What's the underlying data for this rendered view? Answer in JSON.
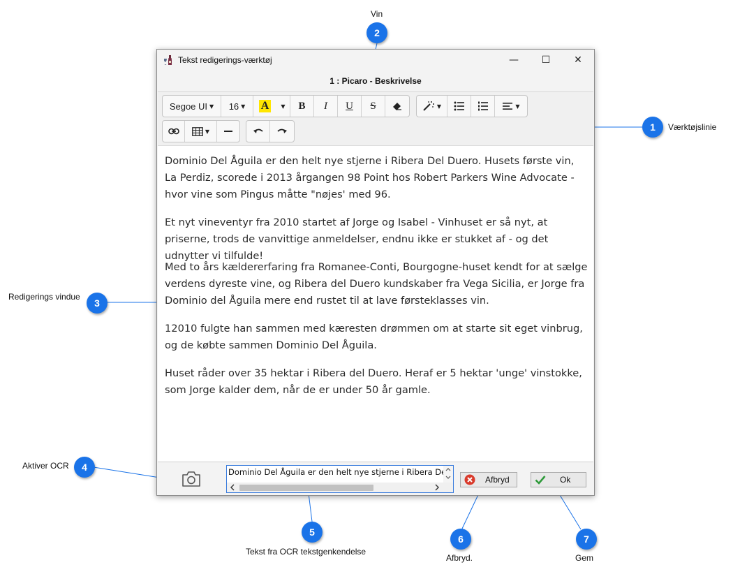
{
  "window": {
    "title": "Tekst redigerings-værktøj",
    "heading": "1 : Picaro - Beskrivelse",
    "minimize_glyph": "—",
    "maximize_glyph": "☐",
    "close_glyph": "✕"
  },
  "toolbar": {
    "font_family": "Segoe UI",
    "font_size": "16",
    "highlight_letter": "A",
    "bold": "B",
    "italic": "I",
    "underline": "U",
    "strike": "S",
    "colors": {
      "highlight": "#ffe600"
    }
  },
  "editor": {
    "paragraphs": [
      "Dominio Del Åguila er den helt nye stjerne i Ribera Del Duero. Husets første vin, La Perdiz, scorede i 2013 årgangen 98 Point hos Robert Parkers Wine Advocate - hvor vine som Pingus måtte \"nøjes' med 96.",
      "Et nyt vineventyr fra 2010 startet af Jorge og Isabel - Vinhuset er så nyt, at priserne, trods de vanvittige anmeldelser, endnu ikke er stukket af - og det udnytter vi tilfulde!",
      "Med to års kældererfaring fra Romanee-Conti, Bourgogne-huset kendt for at sælge verdens dyreste vine, og Ribera del Duero kundskaber fra Vega Sicilia, er Jorge fra Dominio del Åguila mere end rustet til at lave førsteklasses vin.",
      "12010 fulgte han sammen med kæresten drømmen om at starte sit eget vinbrug, og de købte sammen Dominio Del Åguila.",
      "Huset råder over 35 hektar i Ribera del Duero. Heraf er 5 hektar 'unge' vinstokke, som Jorge kalder dem, når de er under 50 år gamle."
    ]
  },
  "bottom": {
    "ocr_text": "Dominio Del Åguila er den helt nye stjerne i Ribera Del Du",
    "cancel_label": "Afbryd",
    "ok_label": "Ok"
  },
  "callouts": {
    "c1": {
      "number": "1",
      "label": "Værktøjslinie"
    },
    "c2": {
      "number": "2",
      "label": "Vin"
    },
    "c3": {
      "number": "3",
      "label": "Redigerings vindue"
    },
    "c4": {
      "number": "4",
      "label": "Aktiver OCR"
    },
    "c5": {
      "number": "5",
      "label": "Tekst fra OCR tekstgenkendelse"
    },
    "c6": {
      "number": "6",
      "label": "Afbryd."
    },
    "c7": {
      "number": "7",
      "label": "Gem"
    },
    "colors": {
      "badge": "#1a73e8",
      "line": "#1a73e8"
    }
  }
}
